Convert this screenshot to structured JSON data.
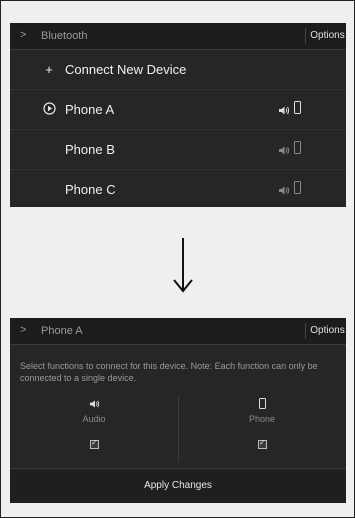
{
  "screen1": {
    "header": {
      "title": "Bluetooth",
      "options_label": "Options"
    },
    "rows": [
      {
        "label": "Connect New Device",
        "leading": "+"
      },
      {
        "label": "Phone A",
        "active": true
      },
      {
        "label": "Phone B",
        "active": false
      },
      {
        "label": "Phone C",
        "active": false
      }
    ]
  },
  "screen2": {
    "header": {
      "title": "Phone A",
      "options_label": "Options"
    },
    "description": "Select functions to connect for this device. Note: Each function can only be connected to a single device.",
    "functions": [
      {
        "label": "Audio",
        "icon": "speaker-icon",
        "checked": true
      },
      {
        "label": "Phone",
        "icon": "phone-icon",
        "checked": true
      }
    ],
    "apply_label": "Apply Changes"
  },
  "colors": {
    "screen_bg": "#262626",
    "header_bg": "#1c1c1c",
    "text": "#f0f0f0",
    "muted": "#9a9a9a"
  }
}
